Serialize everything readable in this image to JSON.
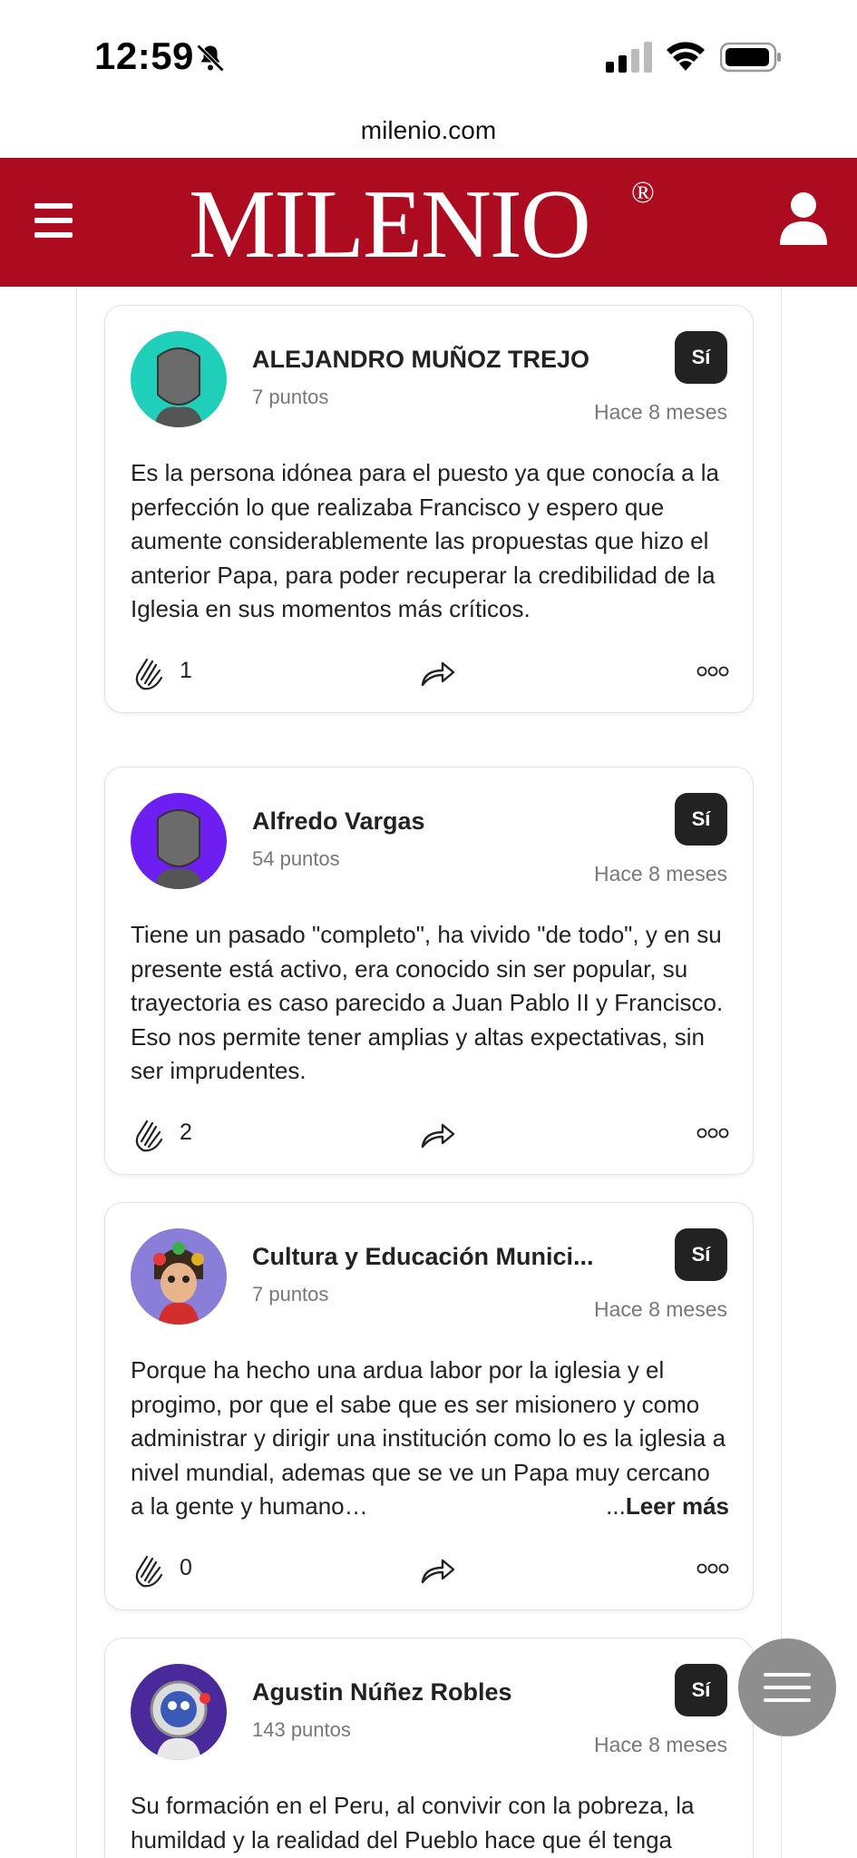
{
  "status_bar": {
    "time": "12:59"
  },
  "browser": {
    "url": "milenio.com"
  },
  "header": {
    "logo": "MILENIO",
    "logo_mark": "®"
  },
  "comments": [
    {
      "author": "ALEJANDRO MUÑOZ TREJO",
      "points": "7 puntos",
      "vote": "Sí",
      "time": "Hace 8 meses",
      "text": "Es la persona idónea para el puesto ya que conocía a la perfección lo que realizaba Francisco y espero que aumente considerablemente las propuestas que hizo el anterior Papa, para  poder recuperar la credibilidad de la Iglesia en sus momentos más críticos.",
      "claps": "1",
      "avatar_color": "#1fcfb9"
    },
    {
      "author": "Alfredo Vargas",
      "points": "54 puntos",
      "vote": "Sí",
      "time": "Hace 8 meses",
      "text": "Tiene un pasado \"completo\", ha vivido \"de todo\", y en su presente está activo, era conocido sin ser popular, su trayectoria es caso parecido a Juan Pablo II y Francisco. Eso nos permite tener amplias y altas expectativas, sin ser imprudentes.",
      "claps": "2",
      "avatar_color": "#6d1ef0"
    },
    {
      "author": "Cultura y Educación Munici...",
      "points": "7 puntos",
      "vote": "Sí",
      "time": "Hace 8 meses",
      "text": "Porque ha hecho una ardua labor por la iglesia y el progimo, por que el sabe que es ser misionero y como administrar y dirigir una institución como lo es la iglesia a nivel mundial, ademas que se ve un Papa muy cercano a la gente y humano…",
      "read_more_dots": "...",
      "read_more": "Leer más",
      "claps": "0",
      "avatar_color": "#8a7fd8"
    },
    {
      "author": "Agustin Núñez Robles",
      "points": "143 puntos",
      "vote": "Sí",
      "time": "Hace 8 meses",
      "text": "Su formación en el Peru, al convivir con la pobreza, la humildad y la realidad del Pueblo hace que él tenga",
      "avatar_color": "#4a2a9a"
    }
  ]
}
